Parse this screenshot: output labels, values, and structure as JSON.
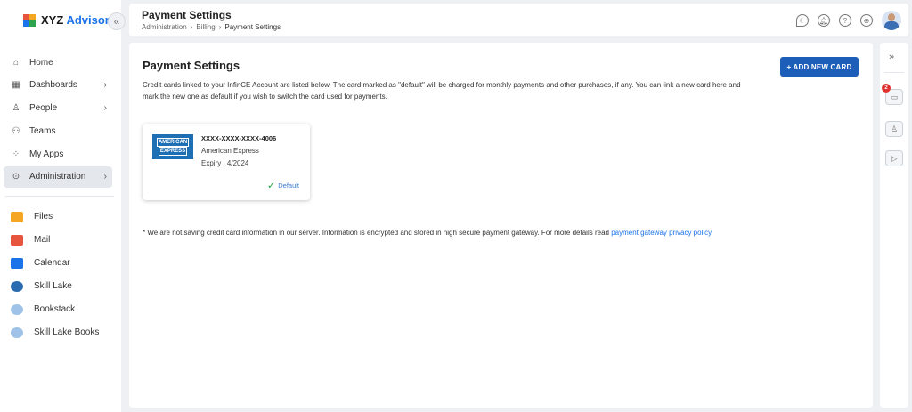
{
  "app": {
    "brand_a": "XYZ",
    "brand_b": "Advisory",
    "collapse_glyph": "«"
  },
  "sidebar": {
    "nav": [
      {
        "label": "Home",
        "icon": "home-icon",
        "glyph": "⌂",
        "chevron": ""
      },
      {
        "label": "Dashboards",
        "icon": "dashboard-icon",
        "glyph": "▦",
        "chevron": "›"
      },
      {
        "label": "People",
        "icon": "person-icon",
        "glyph": "♙",
        "chevron": "›"
      },
      {
        "label": "Teams",
        "icon": "teams-icon",
        "glyph": "⚇",
        "chevron": ""
      },
      {
        "label": "My Apps",
        "icon": "apps-icon",
        "glyph": "⁘",
        "chevron": ""
      },
      {
        "label": "Administration",
        "icon": "admin-icon",
        "glyph": "⊙",
        "chevron": "›"
      }
    ],
    "apps": [
      {
        "label": "Files",
        "icon": "folder-icon",
        "color": "#f5a623"
      },
      {
        "label": "Mail",
        "icon": "mail-icon",
        "color": "#e8553e"
      },
      {
        "label": "Calendar",
        "icon": "calendar-icon",
        "color": "#1a73e8"
      },
      {
        "label": "Skill Lake",
        "icon": "skill-lake-icon",
        "color": "#2b6cb0"
      },
      {
        "label": "Bookstack",
        "icon": "bookstack-icon",
        "color": "#9fc2e8"
      },
      {
        "label": "Skill Lake Books",
        "icon": "skill-lake-books-icon",
        "color": "#9fc2e8"
      }
    ]
  },
  "header": {
    "title": "Payment Settings",
    "breadcrumb": [
      "Administration",
      "Billing",
      "Payment Settings"
    ],
    "sep": "›",
    "icons": [
      "moon-icon",
      "bell-icon",
      "help-icon",
      "globe-icon"
    ]
  },
  "main": {
    "title": "Payment Settings",
    "add_button": "+ ADD NEW CARD",
    "description": "Credit cards linked to your InfinCE Account are listed below. The card marked as \"default\" will be charged for monthly payments and other purchases, if any. You can link a new card here and mark the new one as default if you wish to switch the card used for payments.",
    "card": {
      "logo_line1": "AMERICAN",
      "logo_line2": "EXPRESS",
      "number": "XXXX-XXXX-XXXX-4006",
      "type": "American Express",
      "expiry": "Expiry : 4/2024",
      "default_label": "Default",
      "check": "✓"
    },
    "note_text": "* We are not saving credit card information in our server. Information is encrypted and stored in high secure payment gateway. For more details read ",
    "note_link": "payment gateway privacy policy."
  },
  "rail": {
    "expand_glyph": "»",
    "badge_count": "2"
  },
  "colors": {
    "accent": "#1d5fb8",
    "link": "#1a73e8",
    "success": "#27a745",
    "badge": "#e03131"
  }
}
